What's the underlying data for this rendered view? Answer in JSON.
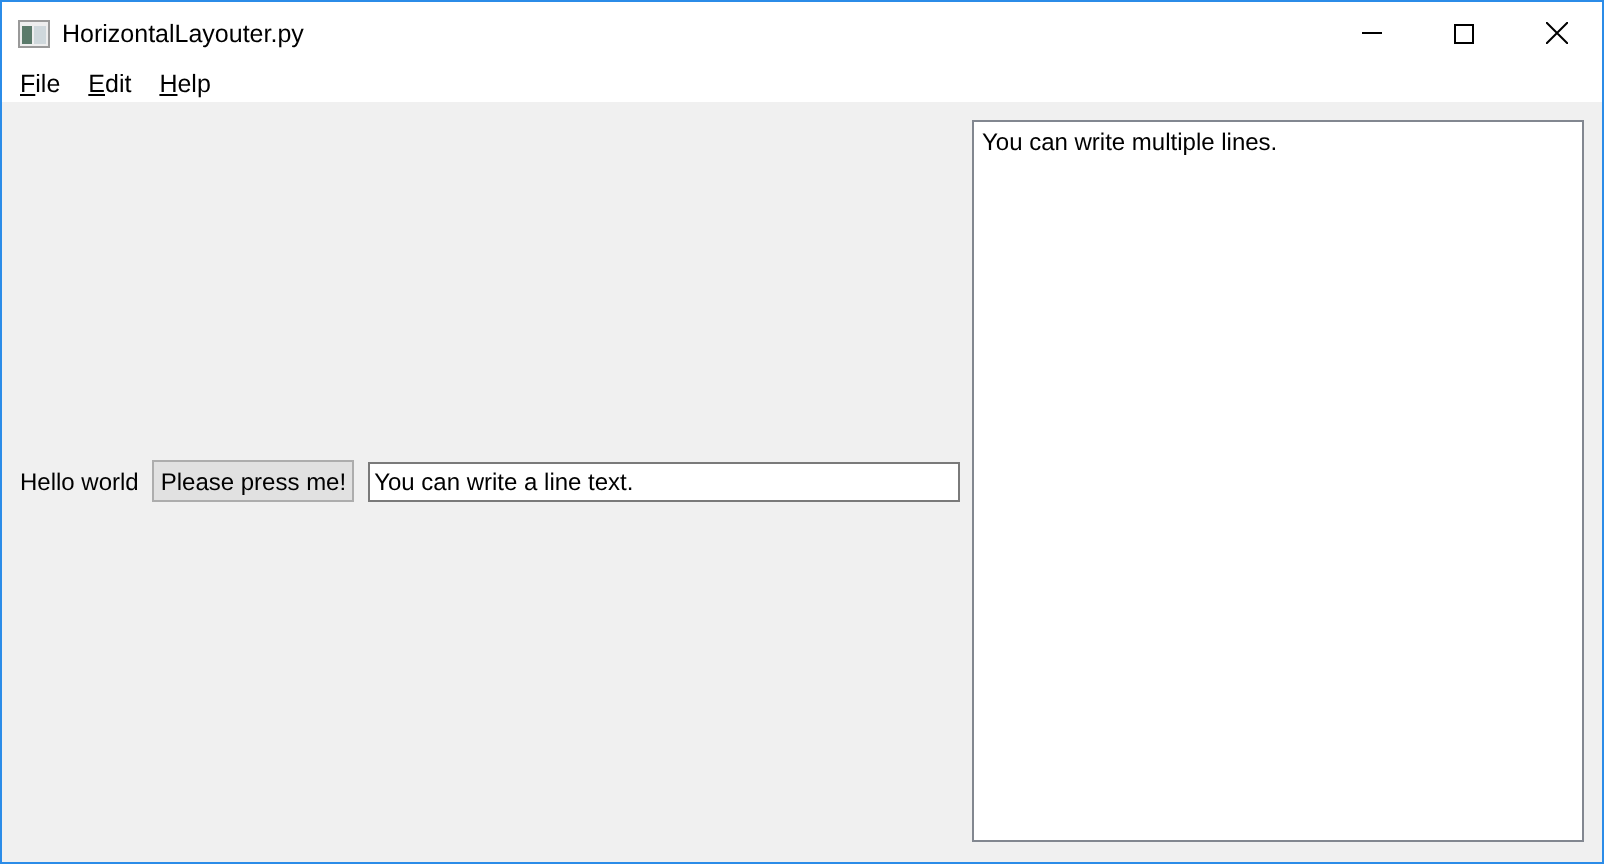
{
  "window": {
    "title": "HorizontalLayouter.py"
  },
  "menu": [
    {
      "label": "File"
    },
    {
      "label": "Edit"
    },
    {
      "label": "Help"
    }
  ],
  "label": {
    "text": "Hello world"
  },
  "button": {
    "label": "Please press me!"
  },
  "line_edit": {
    "value": "You can write a line text."
  },
  "text_edit": {
    "value": "You can write multiple lines."
  }
}
